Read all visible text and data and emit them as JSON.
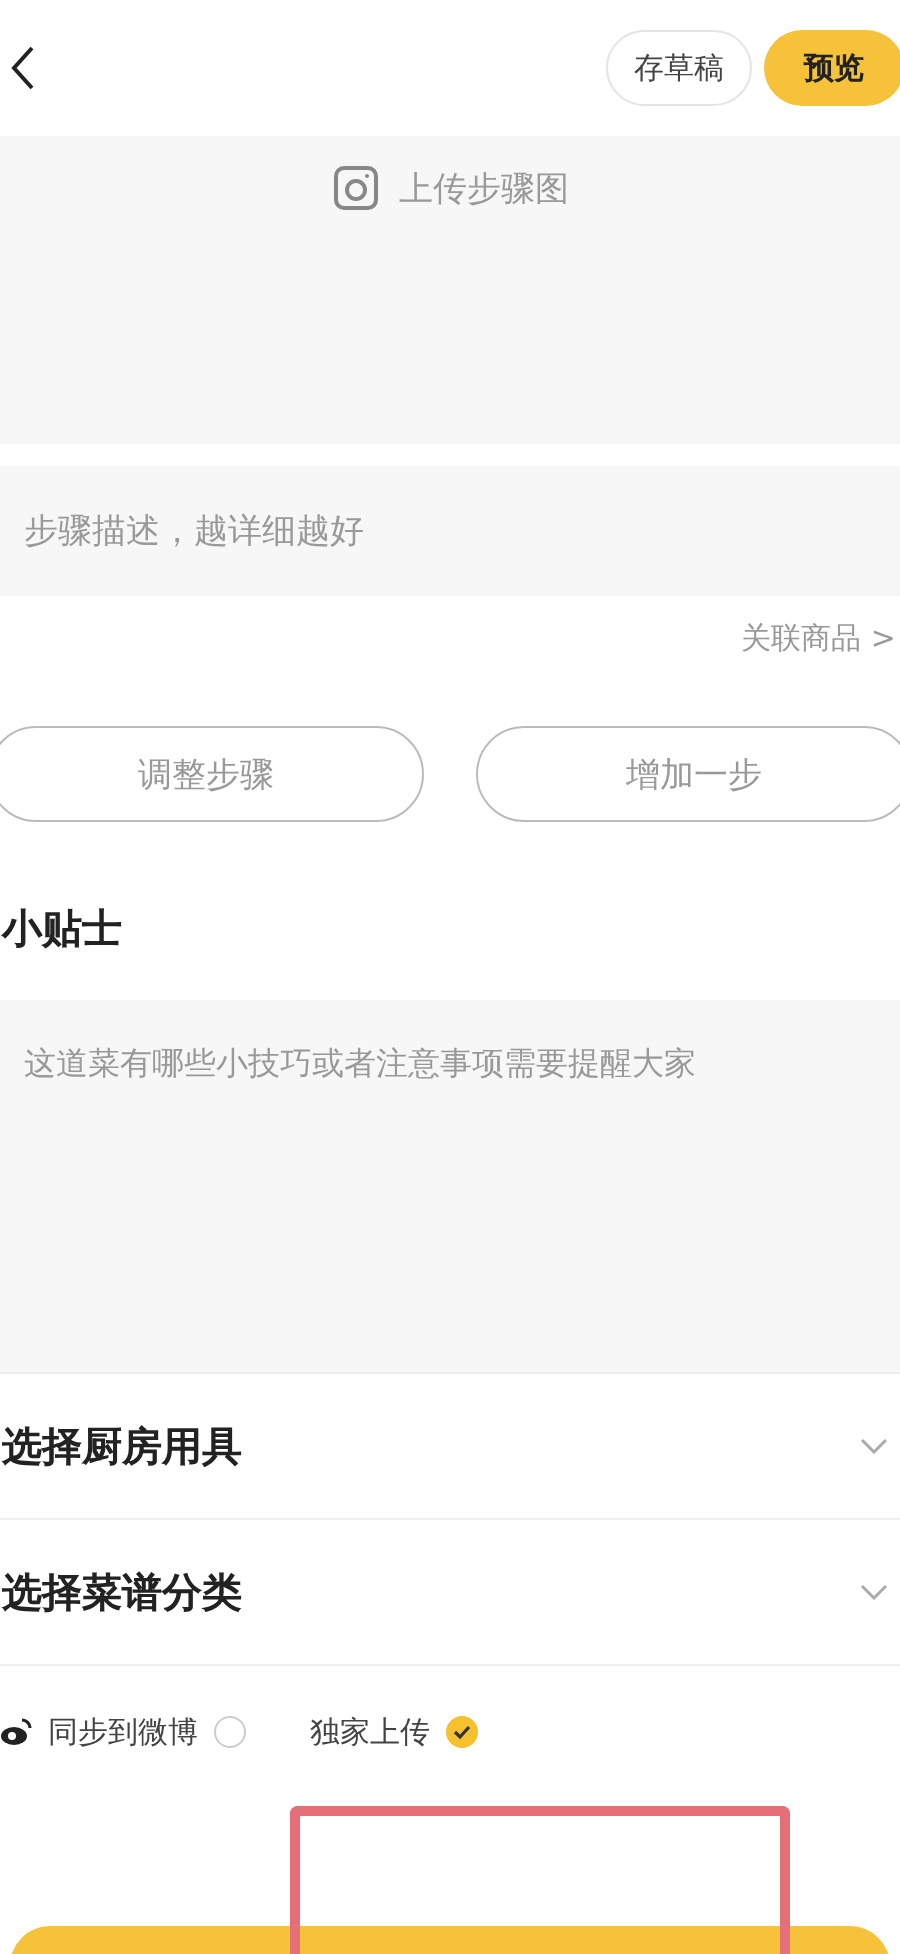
{
  "header": {
    "draft_button": "存草稿",
    "preview_button": "预览"
  },
  "step": {
    "upload_label": "上传步骤图",
    "description_placeholder": "步骤描述，越详细越好",
    "link": "关联商品 >",
    "buttons": [
      "调整步骤",
      "增加一步"
    ]
  },
  "tips": {
    "title": "小贴士",
    "placeholder": "这道菜有哪些小技巧或者注意事项需要提醒大家"
  },
  "selectors": [
    {
      "label": "选择厨房用具"
    },
    {
      "label": "选择菜谱分类"
    }
  ],
  "options": [
    {
      "kind": "weibo",
      "label": "同步到微博",
      "checked": false
    },
    {
      "kind": "plain",
      "label": "独家上传",
      "checked": true
    }
  ]
}
